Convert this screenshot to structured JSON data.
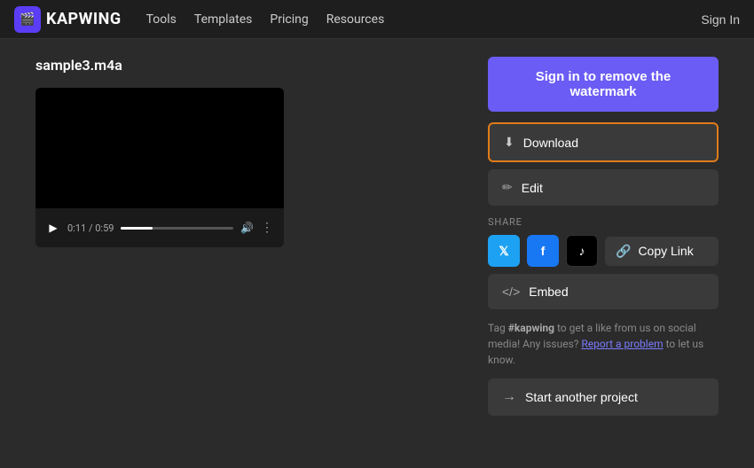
{
  "header": {
    "logo_text": "KAPWING",
    "nav_items": [
      {
        "label": "Tools",
        "id": "tools"
      },
      {
        "label": "Templates",
        "id": "templates"
      },
      {
        "label": "Pricing",
        "id": "pricing"
      },
      {
        "label": "Resources",
        "id": "resources"
      }
    ],
    "sign_in_label": "Sign In"
  },
  "main": {
    "file_title": "sample3.m4a",
    "video": {
      "current_time": "0:11",
      "total_time": "0:59",
      "progress_percent": 28
    },
    "actions": {
      "watermark_label": "Sign in to remove the watermark",
      "download_label": "Download",
      "edit_label": "Edit",
      "share_label": "SHARE",
      "copy_link_label": "Copy Link",
      "embed_label": "Embed",
      "start_project_label": "Start another project"
    },
    "tag_text": {
      "prefix": "Tag ",
      "hashtag": "#kapwing",
      "middle": " to get a like from us on social media! Any issues?",
      "link": "Report a problem",
      "suffix": " to let us know."
    }
  }
}
